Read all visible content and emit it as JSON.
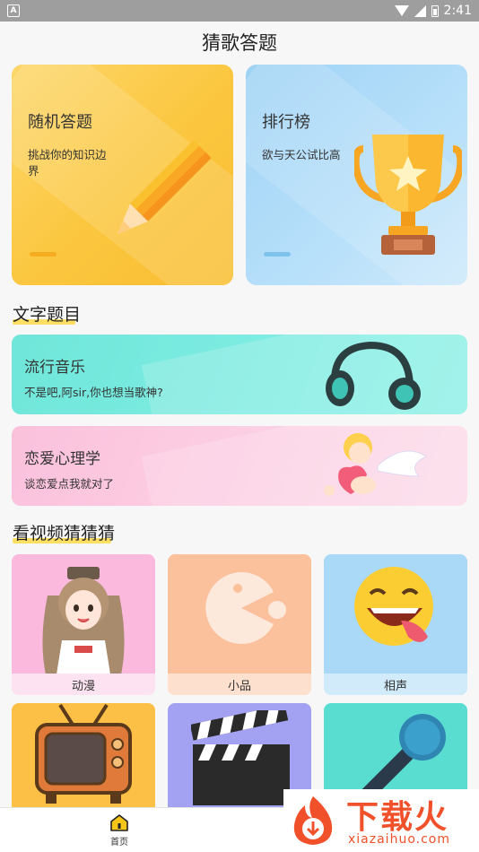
{
  "status_bar": {
    "time": "2:41",
    "app_icon_letter": "A"
  },
  "header": {
    "title": "猜歌答题"
  },
  "top_cards": [
    {
      "title": "随机答题",
      "subtitle": "挑战你的知识边界",
      "image": "pencil-illustration",
      "color": "#fbc63e"
    },
    {
      "title": "排行榜",
      "subtitle": "欲与天公试比高",
      "image": "trophy-illustration",
      "color": "#b8e0fa"
    }
  ],
  "sections": {
    "text_questions": "文字题目",
    "video_guess": "看视频猜猜猜"
  },
  "text_categories": [
    {
      "title": "流行音乐",
      "subtitle": "不是吧,阿sir,你也想当歌神?",
      "image": "headphones-illustration",
      "color": "#7eece2"
    },
    {
      "title": "恋爱心理学",
      "subtitle": "谈恋爱点我就对了",
      "image": "cupid-illustration",
      "color": "#fcd0e4"
    }
  ],
  "video_categories": [
    {
      "label": "动漫",
      "image": "anime-girl-illustration",
      "color": "#fbb9de"
    },
    {
      "label": "小品",
      "image": "pacman-icon",
      "color": "#fbc09c"
    },
    {
      "label": "相声",
      "image": "laughing-emoji-icon",
      "color": "#a9d9f7"
    },
    {
      "label": "",
      "image": "tv-icon",
      "color": "#fcc046"
    },
    {
      "label": "",
      "image": "clapperboard-icon",
      "color": "#a3a2f2"
    },
    {
      "label": "",
      "image": "microphone-icon",
      "color": "#59ddd0"
    }
  ],
  "bottom_nav": {
    "home_label": "首页",
    "accent": "#f5c518"
  },
  "watermark": {
    "text": "下载火",
    "url": "xiazaihuo.com",
    "color": "#f0502a"
  }
}
